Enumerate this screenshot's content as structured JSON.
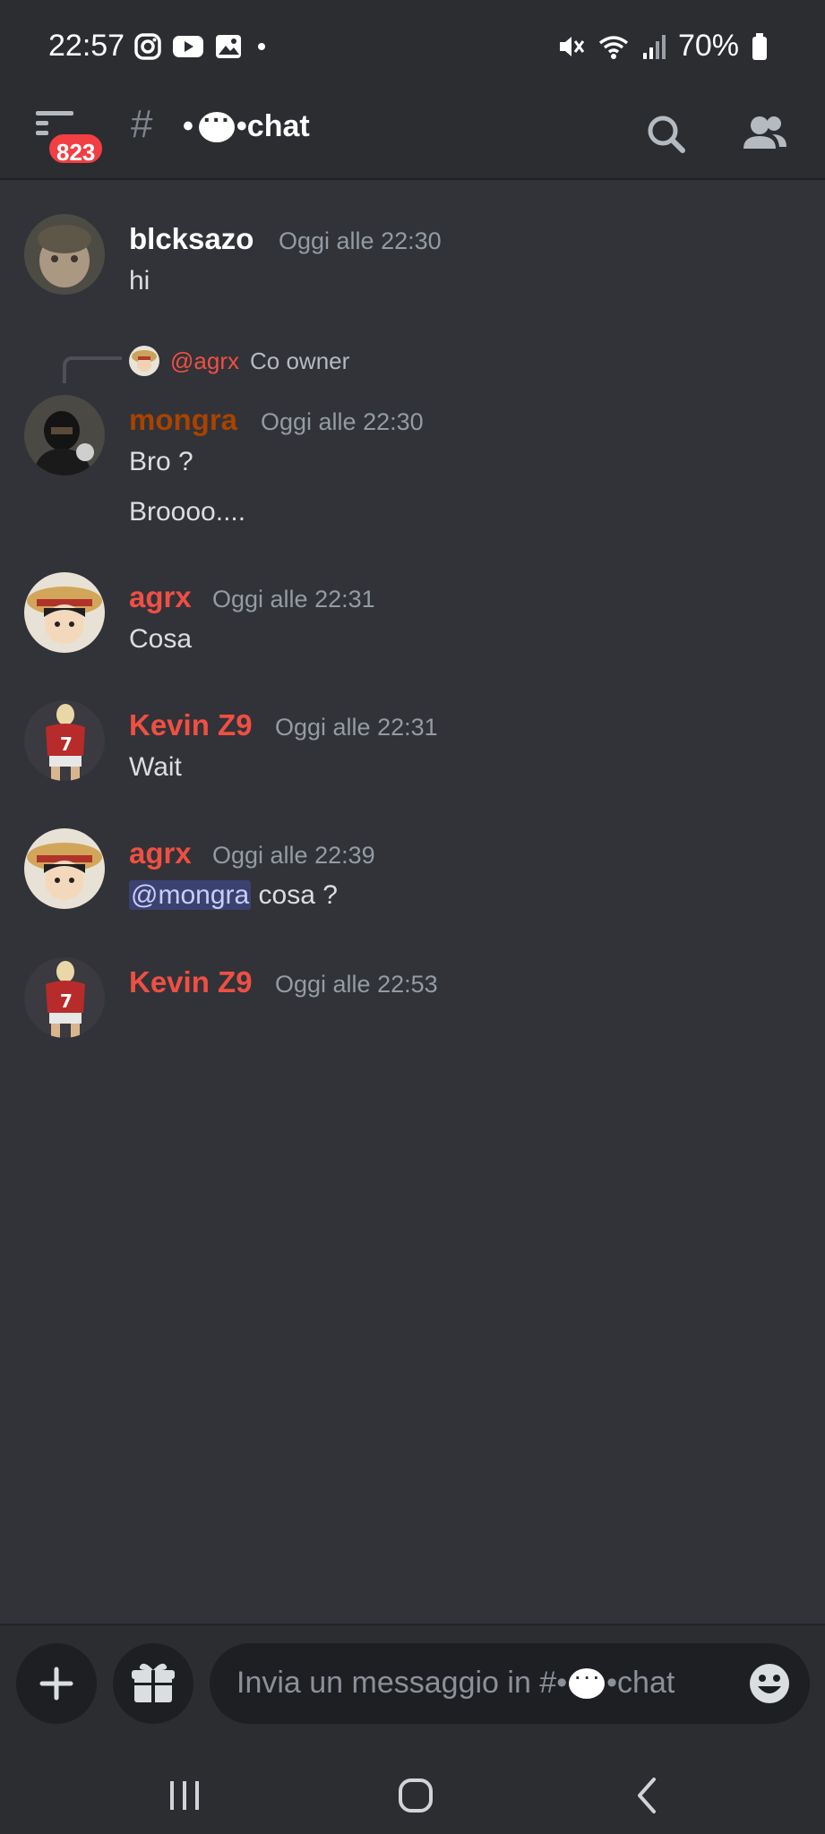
{
  "status_bar": {
    "time": "22:57",
    "left_icons": [
      "instagram-icon",
      "youtube-icon",
      "gallery-icon",
      "dot-icon"
    ],
    "right_icons": [
      "mute-icon",
      "wifi-icon",
      "signal-icon",
      "battery-icon"
    ],
    "battery": "70%"
  },
  "header": {
    "unread_badge": "823",
    "hash": "#",
    "channel_prefix": "•",
    "channel_suffix": "•chat"
  },
  "messages": [
    {
      "author": "blcksazo",
      "timestamp": "Oggi alle 22:30",
      "lines": [
        "hi"
      ],
      "color": "#ffffff"
    },
    {
      "reply_to": {
        "name": "@agrx",
        "text": "Co owner"
      },
      "author": "mongra",
      "timestamp": "Oggi alle 22:30",
      "lines": [
        "Bro ?",
        "Broooo...."
      ],
      "color": "#a84300"
    },
    {
      "author": "agrx",
      "timestamp": "Oggi alle 22:31",
      "lines": [
        "Cosa"
      ],
      "color": "#f04f43"
    },
    {
      "author": "Kevin Z9",
      "timestamp": "Oggi alle 22:31",
      "lines": [
        "Wait"
      ],
      "color": "#f04f43"
    },
    {
      "author": "agrx",
      "timestamp": "Oggi alle 22:39",
      "mention": "@mongra",
      "mention_rest": " cosa ?",
      "color": "#f04f43"
    },
    {
      "author": "Kevin Z9",
      "timestamp": "Oggi alle 22:53",
      "lines": [],
      "color": "#f04f43"
    }
  ],
  "input": {
    "placeholder_before": "Invia un messaggio in #•",
    "placeholder_after": "•chat"
  },
  "icons": {
    "add": "plus-icon",
    "gift": "gift-icon",
    "emoji": "emoji-icon",
    "search": "search-icon",
    "members": "members-icon",
    "menu": "menu-icon"
  }
}
